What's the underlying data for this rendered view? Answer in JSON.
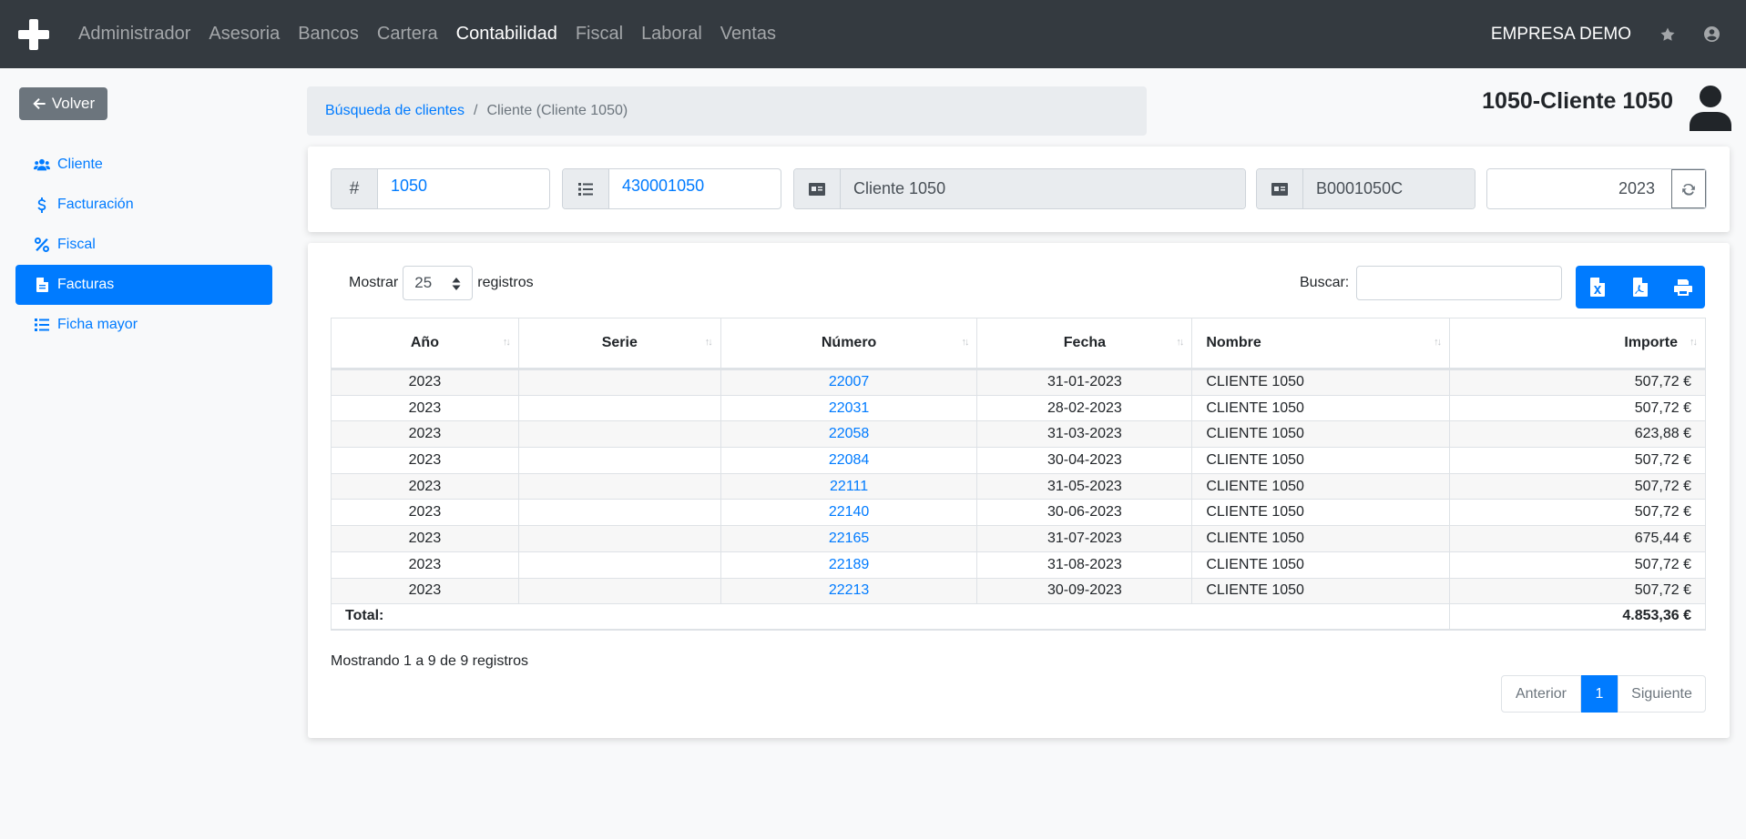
{
  "nav": {
    "items": [
      "Administrador",
      "Asesoria",
      "Bancos",
      "Cartera",
      "Contabilidad",
      "Fiscal",
      "Laboral",
      "Ventas"
    ],
    "active": "Contabilidad",
    "company": "EMPRESA DEMO",
    "icons": [
      "star-icon",
      "user-circle-icon"
    ]
  },
  "back_label": "Volver",
  "sidebar": {
    "items": [
      {
        "label": "Cliente",
        "icon": "users-icon"
      },
      {
        "label": "Facturación",
        "icon": "dollar-icon"
      },
      {
        "label": "Fiscal",
        "icon": "percent-icon"
      },
      {
        "label": "Facturas",
        "icon": "file-icon",
        "active": true
      },
      {
        "label": "Ficha mayor",
        "icon": "list-icon"
      }
    ]
  },
  "breadcrumb": {
    "parent": "Búsqueda de clientes",
    "separator": "/",
    "current": "Cliente (Cliente 1050)"
  },
  "client": {
    "title": "1050-Cliente 1050"
  },
  "fields": {
    "code_prefix": "#",
    "code": "1050",
    "account": "430001050",
    "name": "Cliente 1050",
    "tax_id": "B0001050C",
    "year": "2023"
  },
  "table_controls": {
    "show_label": "Mostrar",
    "page_size": "25",
    "records_label": "registros",
    "search_label": "Buscar:"
  },
  "table": {
    "headers": [
      "Año",
      "Serie",
      "Número",
      "Fecha",
      "Nombre",
      "Importe"
    ],
    "rows": [
      [
        "2023",
        "",
        "22007",
        "31-01-2023",
        "CLIENTE 1050",
        "507,72 €"
      ],
      [
        "2023",
        "",
        "22031",
        "28-02-2023",
        "CLIENTE 1050",
        "507,72 €"
      ],
      [
        "2023",
        "",
        "22058",
        "31-03-2023",
        "CLIENTE 1050",
        "623,88 €"
      ],
      [
        "2023",
        "",
        "22084",
        "30-04-2023",
        "CLIENTE 1050",
        "507,72 €"
      ],
      [
        "2023",
        "",
        "22111",
        "31-05-2023",
        "CLIENTE 1050",
        "507,72 €"
      ],
      [
        "2023",
        "",
        "22140",
        "30-06-2023",
        "CLIENTE 1050",
        "507,72 €"
      ],
      [
        "2023",
        "",
        "22165",
        "31-07-2023",
        "CLIENTE 1050",
        "675,44 €"
      ],
      [
        "2023",
        "",
        "22189",
        "31-08-2023",
        "CLIENTE 1050",
        "507,72 €"
      ],
      [
        "2023",
        "",
        "22213",
        "30-09-2023",
        "CLIENTE 1050",
        "507,72 €"
      ]
    ],
    "total_label": "Total:",
    "total_value": "4.853,36 €"
  },
  "info_text": "Mostrando 1 a 9 de 9 registros",
  "pagination": {
    "prev": "Anterior",
    "current": "1",
    "next": "Siguiente"
  },
  "colors": {
    "navbar": "#343a40",
    "primary": "#007bff",
    "back_button": "#6c757d"
  }
}
